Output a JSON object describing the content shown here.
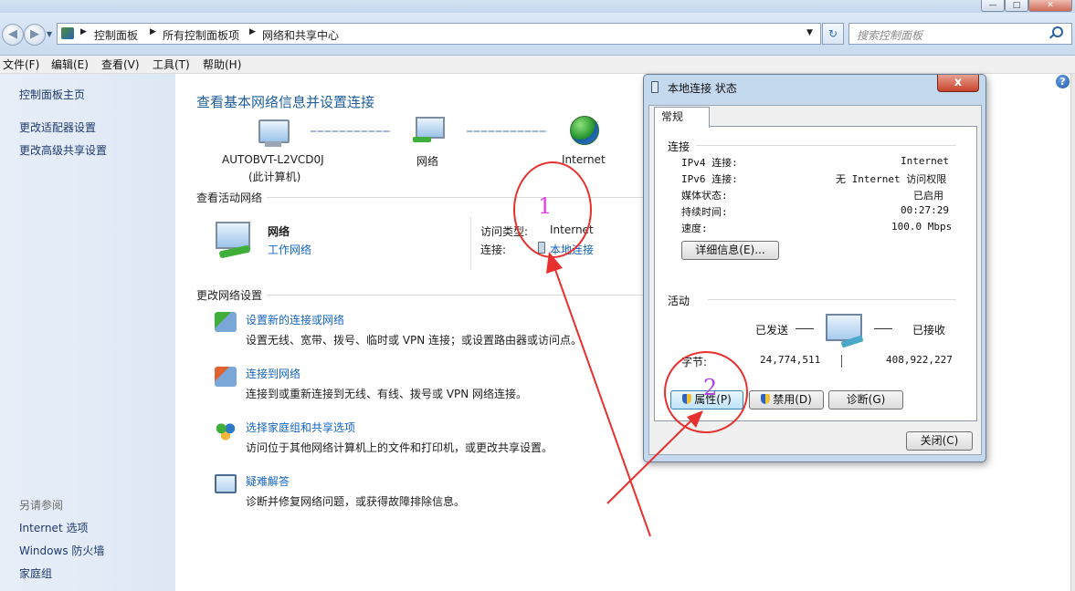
{
  "window": {
    "controls": [
      "—",
      "□",
      "✕"
    ]
  },
  "nav": {
    "breadcrumbs": [
      "控制面板",
      "所有控制面板项",
      "网络和共享中心"
    ],
    "search_placeholder": "搜索控制面板"
  },
  "menu": [
    "文件(F)",
    "编辑(E)",
    "查看(V)",
    "工具(T)",
    "帮助(H)"
  ],
  "sidebar": {
    "top_links": [
      "控制面板主页",
      "更改适配器设置",
      "更改高级共享设置"
    ],
    "see_also_title": "另请参阅",
    "see_also_links": [
      "Internet 选项",
      "Windows 防火墙",
      "家庭组"
    ]
  },
  "main": {
    "title": "查看基本网络信息并设置连接",
    "map": {
      "computer_name": "AUTOBVT-L2VCD0J",
      "computer_sub": "(此计算机)",
      "network": "网络",
      "internet": "Internet"
    },
    "active_section": "查看活动网络",
    "active": {
      "name": "网络",
      "type_link": "工作网络",
      "access_label": "访问类型:",
      "access_value": "Internet",
      "conn_label": "连接:",
      "conn_value": "本地连接"
    },
    "change_section": "更改网络设置",
    "tasks": [
      {
        "title": "设置新的连接或网络",
        "desc": "设置无线、宽带、拨号、临时或 VPN 连接；或设置路由器或访问点。"
      },
      {
        "title": "连接到网络",
        "desc": "连接到或重新连接到无线、有线、拨号或 VPN 网络连接。"
      },
      {
        "title": "选择家庭组和共享选项",
        "desc": "访问位于其他网络计算机上的文件和打印机，或更改共享设置。"
      },
      {
        "title": "疑难解答",
        "desc": "诊断并修复网络问题，或获得故障排除信息。"
      }
    ]
  },
  "dialog": {
    "title": "本地连接 状态",
    "close_glyph": "x",
    "tab": "常规",
    "connection_heading": "连接",
    "rows": [
      {
        "label": "IPv4 连接:",
        "value": "Internet"
      },
      {
        "label": "IPv6 连接:",
        "value": "无 Internet 访问权限"
      },
      {
        "label": "媒体状态:",
        "value": "已启用"
      },
      {
        "label": "持续时间:",
        "value": "00:27:29"
      },
      {
        "label": "速度:",
        "value": "100.0 Mbps"
      }
    ],
    "details_button": "详细信息(E)...",
    "activity_heading": "活动",
    "sent_label": "已发送",
    "received_label": "已接收",
    "bytes_label": "字节:",
    "bytes_sent": "24,774,511",
    "bytes_received": "408,922,227",
    "buttons": {
      "properties": "属性(P)",
      "disable": "禁用(D)",
      "diagnose": "诊断(G)"
    },
    "close_button": "关闭(C)"
  },
  "annotations": {
    "one": "1",
    "two": "2",
    "colors": {
      "one": "#e040e0",
      "two": "#b040e0",
      "marker": "#e8302e"
    }
  },
  "colors": {
    "link": "#1565c0",
    "title": "#1e5e9c"
  }
}
